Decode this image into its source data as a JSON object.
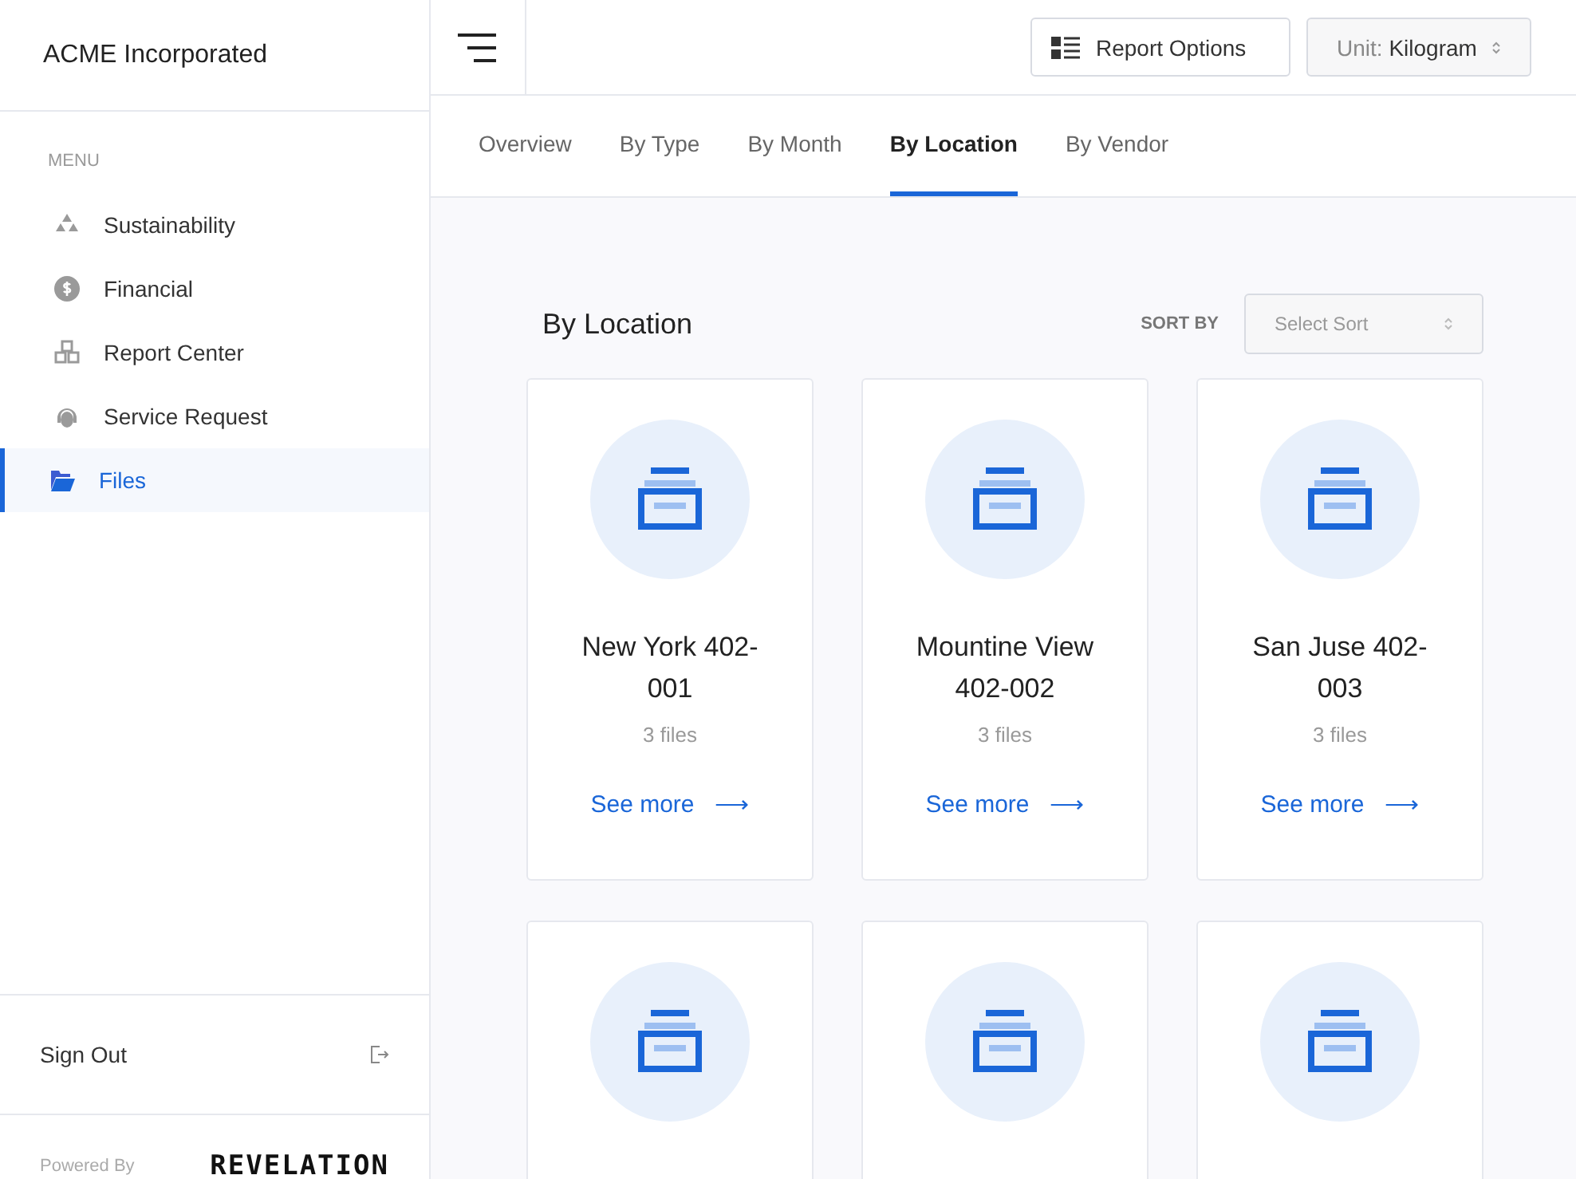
{
  "brand": "ACME Incorporated",
  "sidebar": {
    "heading": "MENU",
    "items": [
      {
        "label": "Sustainability",
        "selected": false
      },
      {
        "label": "Financial",
        "selected": false
      },
      {
        "label": "Report Center",
        "selected": false
      },
      {
        "label": "Service Request",
        "selected": false
      },
      {
        "label": "Files",
        "selected": true
      }
    ],
    "sign_out": "Sign Out",
    "powered_by": "Powered By",
    "logo": "REVELATION"
  },
  "header": {
    "report_options": "Report Options",
    "unit_label": "Unit:",
    "unit_value": "Kilogram"
  },
  "tabs": [
    {
      "label": "Overview",
      "selected": false
    },
    {
      "label": "By Type",
      "selected": false
    },
    {
      "label": "By Month",
      "selected": false
    },
    {
      "label": "By Location",
      "selected": true
    },
    {
      "label": "By Vendor",
      "selected": false
    }
  ],
  "section": {
    "title": "By Location",
    "sort_label": "SORT BY",
    "sort_placeholder": "Select Sort"
  },
  "cards": [
    {
      "kind": "full",
      "title": "New York 402-001",
      "count": "3 files",
      "link": "See more",
      "arrow": "⟶"
    },
    {
      "kind": "full",
      "title": "Mountine View 402-002",
      "count": "3 files",
      "link": "See more",
      "arrow": "⟶"
    },
    {
      "kind": "full",
      "title": "San Juse 402-003",
      "count": "3 files",
      "link": "See more",
      "arrow": "⟶"
    },
    {
      "kind": "cut"
    },
    {
      "kind": "cut"
    },
    {
      "kind": "cut"
    }
  ]
}
